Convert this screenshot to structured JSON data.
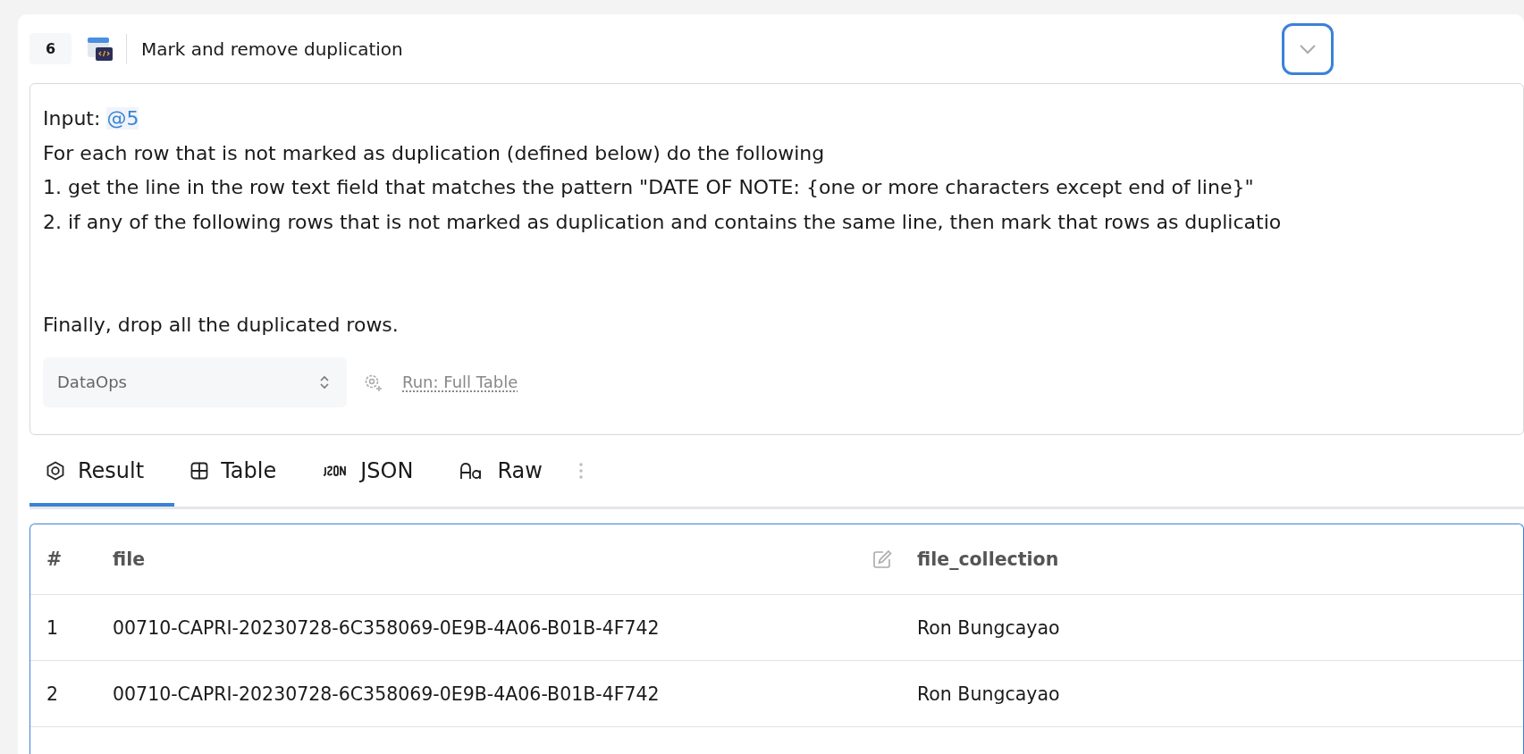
{
  "cell": {
    "number": "6",
    "title": "Mark and remove duplication",
    "expanded": false
  },
  "prompt": {
    "lines": [
      "Input: **@5**",
      "For each row that is not marked as duplication (defined below) do the following",
      "1. get the line in the row text field that matches the pattern \"DATE OF NOTE: {one or more characters except end of line}\"",
      "2. if any of the following rows that is not marked as duplication and contains the same line, then mark that rows as duplicatio"
    ],
    "closing": "Finally, drop all the duplicated rows."
  },
  "toolbar": {
    "engine": "DataOps",
    "run_scope": "Run: Full Table"
  },
  "tabs": [
    {
      "label": "Result",
      "kind": "result",
      "selected": true
    },
    {
      "label": "Table",
      "kind": "table",
      "selected": false
    },
    {
      "label": "JSON",
      "kind": "json",
      "selected": false
    },
    {
      "label": "Raw",
      "kind": "raw",
      "selected": false
    }
  ],
  "table": {
    "columns": [
      "#",
      "file",
      "file_collection"
    ],
    "rows": [
      [
        "1",
        "00710-CAPRI-20230728-6C358069-0E9B-4A06-B01B-4F742",
        "Ron Bungcayao"
      ],
      [
        "2",
        "00710-CAPRI-20230728-6C358069-0E9B-4A06-B01B-4F742",
        "Ron Bungcayao"
      ]
    ]
  }
}
